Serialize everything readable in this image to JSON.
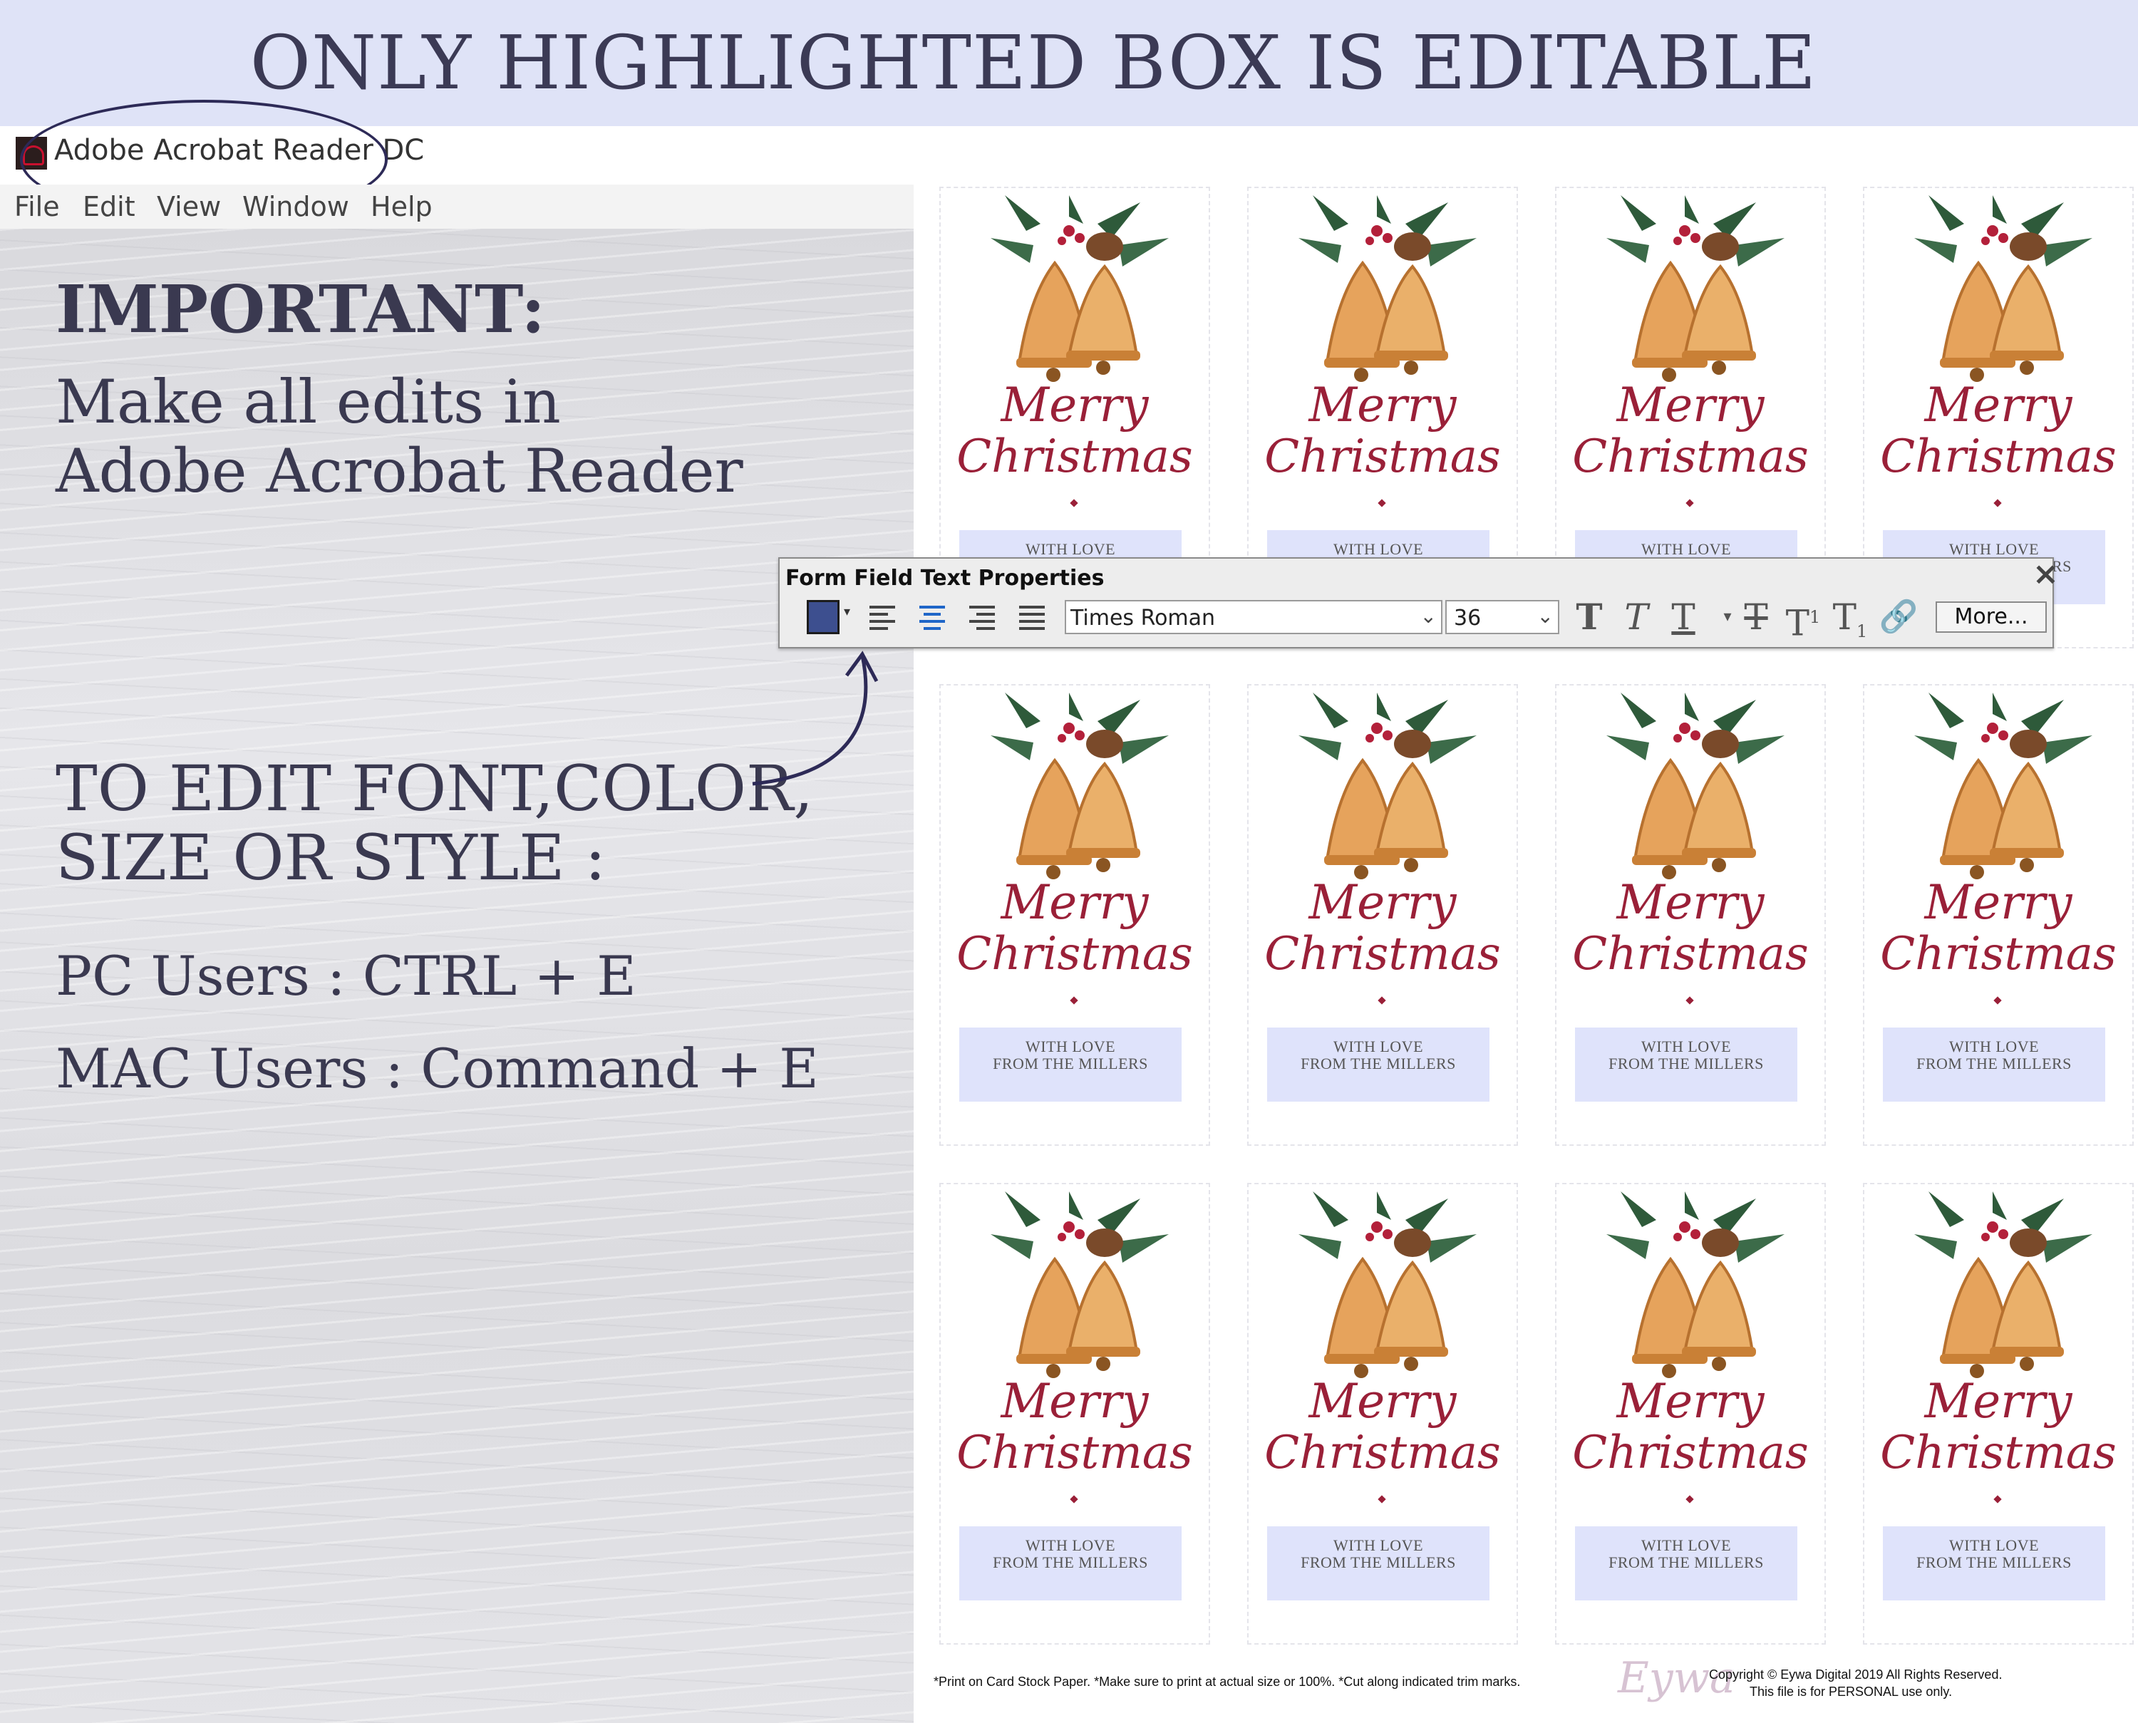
{
  "banner": {
    "text": "ONLY HIGHLIGHTED BOX IS EDITABLE"
  },
  "app": {
    "title": "Adobe Acrobat Reader DC",
    "menu": [
      "File",
      "Edit",
      "View",
      "Window",
      "Help"
    ]
  },
  "instructions": {
    "important": "IMPORTANT:",
    "make_line1": "Make all edits in",
    "make_line2": "Adobe Acrobat Reader",
    "edit_line1": "TO EDIT FONT,COLOR,",
    "edit_line2": "SIZE OR STYLE :",
    "pc": "PC Users : CTRL + E",
    "mac": "MAC Users : Command + E"
  },
  "toolbar": {
    "title": "Form Field Text Properties",
    "close_icon": "close-icon",
    "text_color": "#3d4f8f",
    "font": "Times Roman",
    "size": "36",
    "more_label": "More...",
    "alignments": [
      "align-left",
      "align-center",
      "align-right",
      "justify",
      "justify-all"
    ],
    "active_alignment": "align-center",
    "styles": [
      "bold",
      "italic",
      "underline",
      "strikethrough",
      "superscript",
      "subscript",
      "link"
    ]
  },
  "tag": {
    "line1": "WITH LOVE",
    "line2": "FROM THE MILLERS",
    "merry": "Merry",
    "christmas": "Christmas"
  },
  "footer": {
    "note": "*Print on Card Stock Paper. *Make sure to print at actual size or 100%. *Cut along indicated trim marks.",
    "signature": "Eywa",
    "copyright_line1": "Copyright © Eywa Digital 2019 All Rights Reserved.",
    "copyright_line2": "This file is for PERSONAL use only."
  },
  "colors": {
    "banner_bg": "#dfe3f7",
    "accent_red": "#9a2038",
    "field_highlight": "#dfe3fb",
    "text_dark": "#3a3950"
  }
}
